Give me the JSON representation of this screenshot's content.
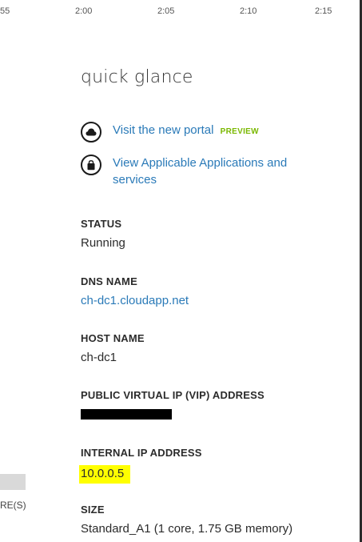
{
  "time_axis": {
    "ticks": [
      "55",
      "2:00",
      "2:05",
      "2:10",
      "2:15"
    ]
  },
  "panel": {
    "title": "quick glance",
    "links": {
      "portal": {
        "label": "Visit the new portal",
        "badge": "PREVIEW",
        "icon": "cloud-icon"
      },
      "applications": {
        "label_line1": "View Applicable Applications and",
        "label_line2": "services",
        "icon": "bag-icon"
      }
    },
    "fields": {
      "status": {
        "label": "STATUS",
        "value": "Running"
      },
      "dns": {
        "label": "DNS NAME",
        "value": "ch-dc1.cloudapp.net"
      },
      "host": {
        "label": "HOST NAME",
        "value": "ch-dc1"
      },
      "vip": {
        "label": "PUBLIC VIRTUAL IP (VIP) ADDRESS"
      },
      "internal_ip": {
        "label": "INTERNAL IP ADDRESS",
        "value": "10.0.0.5"
      },
      "size": {
        "label": "SIZE",
        "value": "Standard_A1 (1 core, 1.75 GB memory)"
      }
    }
  },
  "left_edge": {
    "partial_text": "RE(S)"
  },
  "colors": {
    "link": "#2a7ab8",
    "preview_badge": "#7ab800",
    "highlight": "#ffff00",
    "text": "#2b2b2b"
  }
}
